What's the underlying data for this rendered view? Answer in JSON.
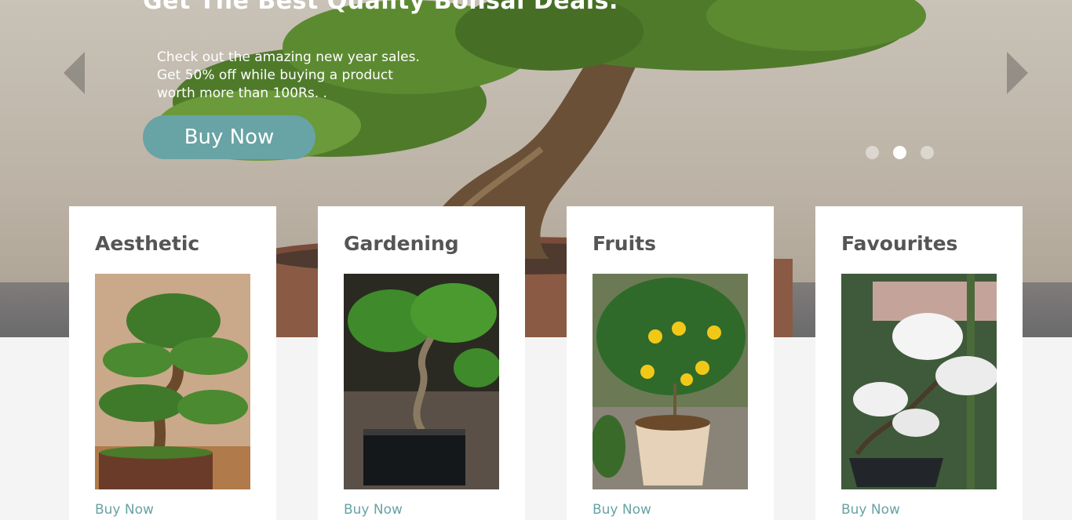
{
  "hero": {
    "title": "Get The Best Quality Bonsai Deals.",
    "lines": [
      "Check out the amazing new year sales.",
      "Get 50% off while buying a product",
      "worth more than 100Rs. ."
    ],
    "cta_label": "Buy Now",
    "slide_count": 3,
    "active_slide": 2,
    "prev_icon": "chevron-left-icon",
    "next_icon": "chevron-right-icon"
  },
  "cards": [
    {
      "title": "Aesthetic",
      "link_label": "Buy Now",
      "image": "bonsai-juniper"
    },
    {
      "title": "Gardening",
      "link_label": "Buy Now",
      "image": "bonsai-ficus"
    },
    {
      "title": "Fruits",
      "link_label": "Buy Now",
      "image": "lemon-tree"
    },
    {
      "title": "Favourites",
      "link_label": "Buy Now",
      "image": "flowering-bonsai"
    }
  ],
  "colors": {
    "accent": "#68a3a5",
    "card_title": "#555555",
    "page_bg": "#f4f4f4"
  }
}
